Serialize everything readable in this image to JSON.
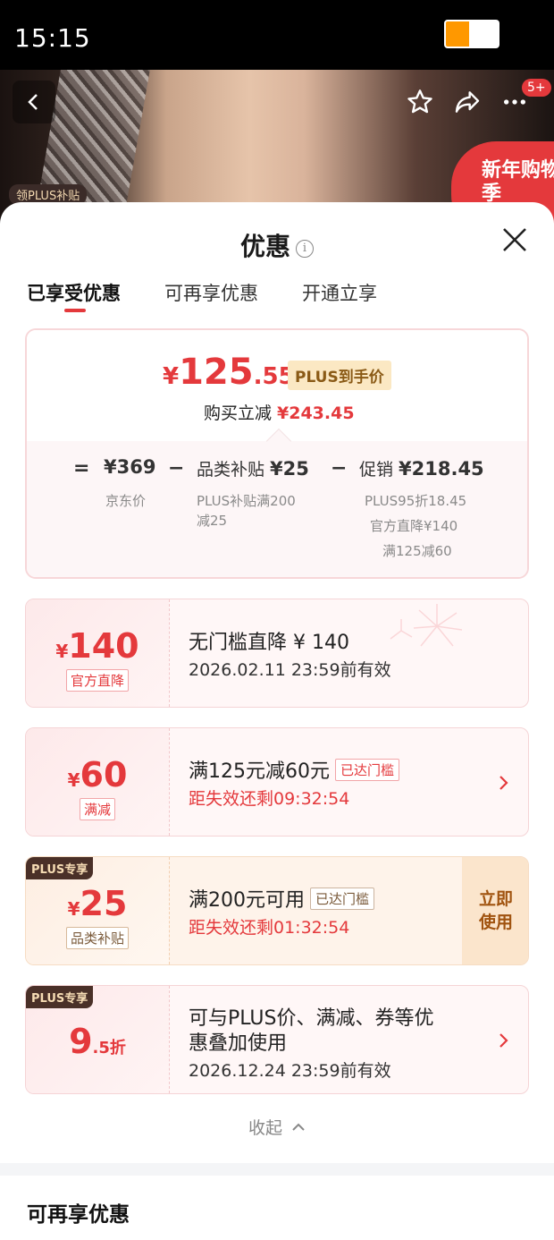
{
  "status_bar": {
    "time": "15:15",
    "battery_level": 0.45
  },
  "product": {
    "plus_sub_tag": "领PLUS补贴",
    "promo_text": "新年购物季",
    "message_badge": "5+",
    "icons": [
      "back-icon",
      "star-icon",
      "share-icon",
      "more-icon"
    ]
  },
  "sheet": {
    "title": "优惠",
    "tabs": [
      {
        "label": "已享受优惠",
        "active": true
      },
      {
        "label": "可再享优惠",
        "active": false
      },
      {
        "label": "开通立享",
        "active": false
      }
    ],
    "summary": {
      "price_symbol": "¥",
      "price_int": "125",
      "price_dec": ".55",
      "plus_badge": "PLUS到手价",
      "reduce_label": "购买立减",
      "reduce_amount": "¥243.45",
      "eq": "=",
      "minus": "−",
      "jd_price": "¥369",
      "jd_price_label": "京东价",
      "category_label": "品类补贴",
      "category_amount": "¥25",
      "category_sub_1": "PLUS补贴满200",
      "category_sub_2": "减25",
      "promo_label": "促销",
      "promo_amount": "¥218.45",
      "promo_sub_1": "PLUS95折18.45",
      "promo_sub_2": "官方直降¥140",
      "promo_sub_3": "满125减60"
    },
    "coupons": [
      {
        "sym": "¥",
        "amount": "140",
        "type": "官方直降",
        "title": "无门槛直降 ¥ 140",
        "sub": "2026.02.11 23:59前有效"
      },
      {
        "sym": "¥",
        "amount": "60",
        "type": "满减",
        "title": "满125元减60元",
        "badge": "已达门槛",
        "sub": "距失效还剩09:32:54"
      },
      {
        "plus_tag": "PLUS专享",
        "sym": "¥",
        "amount": "25",
        "type": "品类补贴",
        "title": "满200元可用",
        "badge": "已达门槛",
        "sub": "距失效还剩01:32:54",
        "action": "立即使用"
      },
      {
        "plus_tag": "PLUS专享",
        "amount": "9",
        "suffix": ".5折",
        "title_1": "可与PLUS价、满减、券等优",
        "title_2": "惠叠加使用",
        "sub": "2026.12.24 23:59前有效"
      }
    ],
    "collapse_label": "收起",
    "next_section": "可再享优惠"
  },
  "colors": {
    "accent": "#e4393c",
    "plus_gold": "#f6dcb4",
    "card_bg": "#fff7f7"
  }
}
